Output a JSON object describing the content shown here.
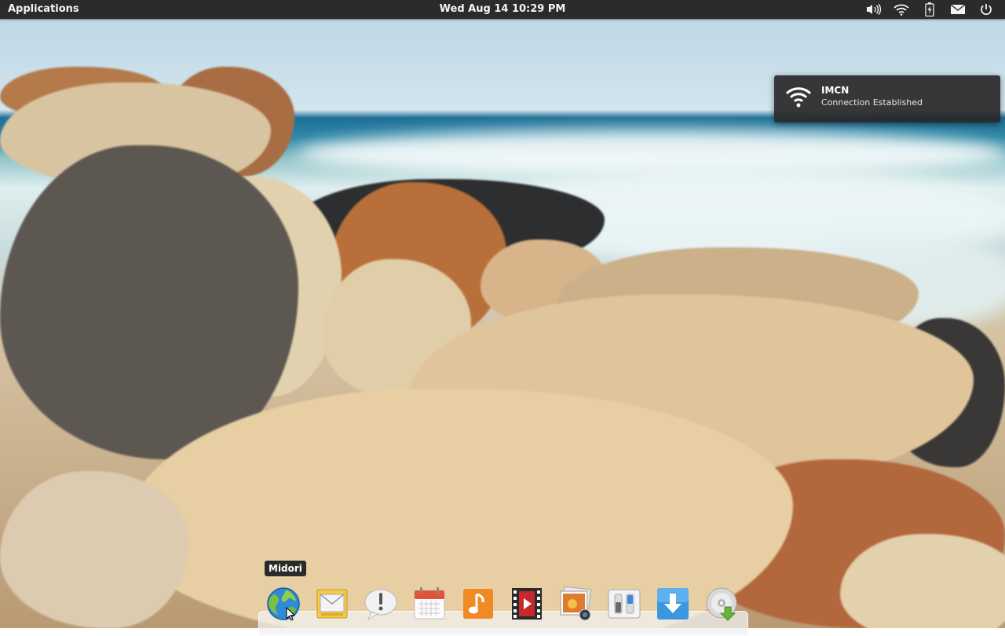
{
  "panel": {
    "applications_label": "Applications",
    "clock": "Wed Aug 14 10:29 PM",
    "indicators": [
      "volume-icon",
      "wifi-icon",
      "battery-icon",
      "mail-icon",
      "power-icon"
    ]
  },
  "notification": {
    "icon": "wifi-icon",
    "title": "IMCN",
    "body": "Connection Established"
  },
  "dock": {
    "tooltip": "Midori",
    "items": [
      {
        "name": "midori",
        "icon": "web-browser-icon"
      },
      {
        "name": "mail",
        "icon": "mail-client-icon"
      },
      {
        "name": "feedback",
        "icon": "speech-bubble-icon"
      },
      {
        "name": "calendar",
        "icon": "calendar-icon"
      },
      {
        "name": "music",
        "icon": "music-icon"
      },
      {
        "name": "videos",
        "icon": "video-player-icon"
      },
      {
        "name": "photos",
        "icon": "photos-icon"
      },
      {
        "name": "system-settings",
        "icon": "settings-toggles-icon"
      },
      {
        "name": "software-center",
        "icon": "download-arrow-icon"
      },
      {
        "name": "disc-installer",
        "icon": "disc-install-icon"
      }
    ]
  },
  "colors": {
    "panel_bg": "#2b2b2b",
    "notification_bg": "#282828",
    "dock_bg": "#f0f0f0"
  }
}
